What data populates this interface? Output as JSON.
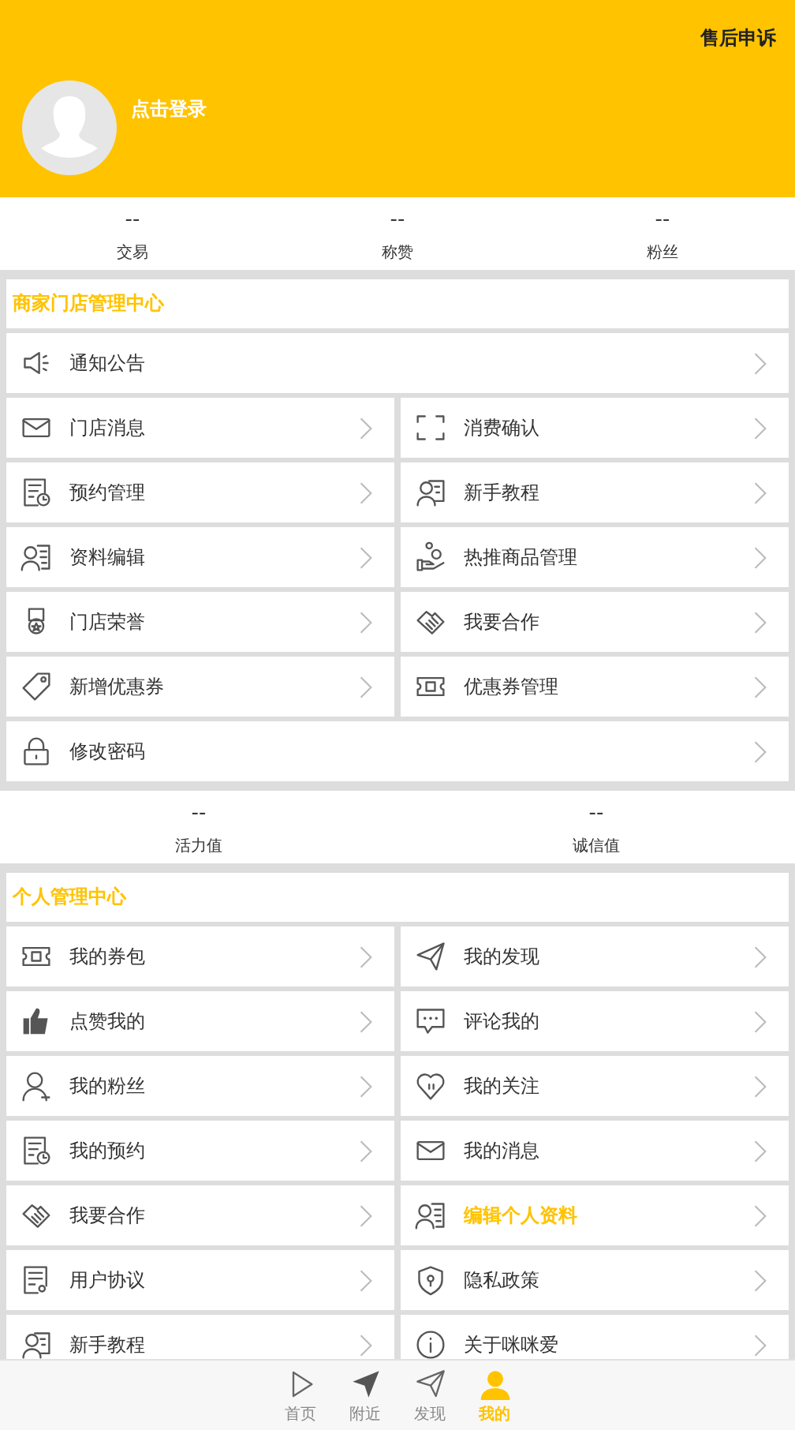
{
  "header": {
    "action": "售后申诉",
    "login": "点击登录"
  },
  "stats": [
    {
      "value": "--",
      "label": "交易"
    },
    {
      "value": "--",
      "label": "称赞"
    },
    {
      "value": "--",
      "label": "粉丝"
    }
  ],
  "merchant": {
    "title": "商家门店管理中心",
    "items": [
      {
        "label": "通知公告",
        "kind": "megaphone",
        "wide": true,
        "highlighted": false
      },
      {
        "label": "门店消息",
        "kind": "mail",
        "wide": false,
        "highlighted": false
      },
      {
        "label": "消费确认",
        "kind": "scan",
        "wide": false,
        "highlighted": false
      },
      {
        "label": "预约管理",
        "kind": "schedule",
        "wide": false,
        "highlighted": false
      },
      {
        "label": "新手教程",
        "kind": "tutorial",
        "wide": false,
        "highlighted": false
      },
      {
        "label": "资料编辑",
        "kind": "profile",
        "wide": false,
        "highlighted": false
      },
      {
        "label": "热推商品管理",
        "kind": "hand",
        "wide": false,
        "highlighted": false
      },
      {
        "label": "门店荣誉",
        "kind": "medal",
        "wide": false,
        "highlighted": false
      },
      {
        "label": "我要合作",
        "kind": "handshake",
        "wide": false,
        "highlighted": false
      },
      {
        "label": "新增优惠券",
        "kind": "tag",
        "wide": false,
        "highlighted": false
      },
      {
        "label": "优惠券管理",
        "kind": "ticket",
        "wide": false,
        "highlighted": false
      },
      {
        "label": "修改密码",
        "kind": "lock",
        "wide": true,
        "highlighted": false
      }
    ]
  },
  "stats2": [
    {
      "value": "--",
      "label": "活力值"
    },
    {
      "value": "--",
      "label": "诚信值"
    }
  ],
  "personal": {
    "title": "个人管理中心",
    "items": [
      {
        "label": "我的券包",
        "kind": "ticket",
        "wide": false,
        "highlighted": false
      },
      {
        "label": "我的发现",
        "kind": "plane",
        "wide": false,
        "highlighted": false
      },
      {
        "label": "点赞我的",
        "kind": "thumb",
        "wide": false,
        "highlighted": false
      },
      {
        "label": "评论我的",
        "kind": "chat",
        "wide": false,
        "highlighted": false
      },
      {
        "label": "我的粉丝",
        "kind": "person",
        "wide": false,
        "highlighted": false
      },
      {
        "label": "我的关注",
        "kind": "heart",
        "wide": false,
        "highlighted": false
      },
      {
        "label": "我的预约",
        "kind": "schedule",
        "wide": false,
        "highlighted": false
      },
      {
        "label": "我的消息",
        "kind": "mail",
        "wide": false,
        "highlighted": false
      },
      {
        "label": "我要合作",
        "kind": "handshake",
        "wide": false,
        "highlighted": false
      },
      {
        "label": "编辑个人资料",
        "kind": "profile",
        "wide": false,
        "highlighted": true
      },
      {
        "label": "用户协议",
        "kind": "document",
        "wide": false,
        "highlighted": false
      },
      {
        "label": "隐私政策",
        "kind": "shield",
        "wide": false,
        "highlighted": false
      },
      {
        "label": "新手教程",
        "kind": "tutorial",
        "wide": false,
        "highlighted": false
      },
      {
        "label": "关于咪咪爱",
        "kind": "info",
        "wide": false,
        "highlighted": false
      }
    ]
  },
  "tabbar": [
    {
      "label": "首页",
      "kind": "play",
      "selected": false
    },
    {
      "label": "附近",
      "kind": "navigate",
      "selected": false
    },
    {
      "label": "发现",
      "kind": "plane",
      "selected": false
    },
    {
      "label": "我的",
      "kind": "user",
      "selected": true
    }
  ]
}
